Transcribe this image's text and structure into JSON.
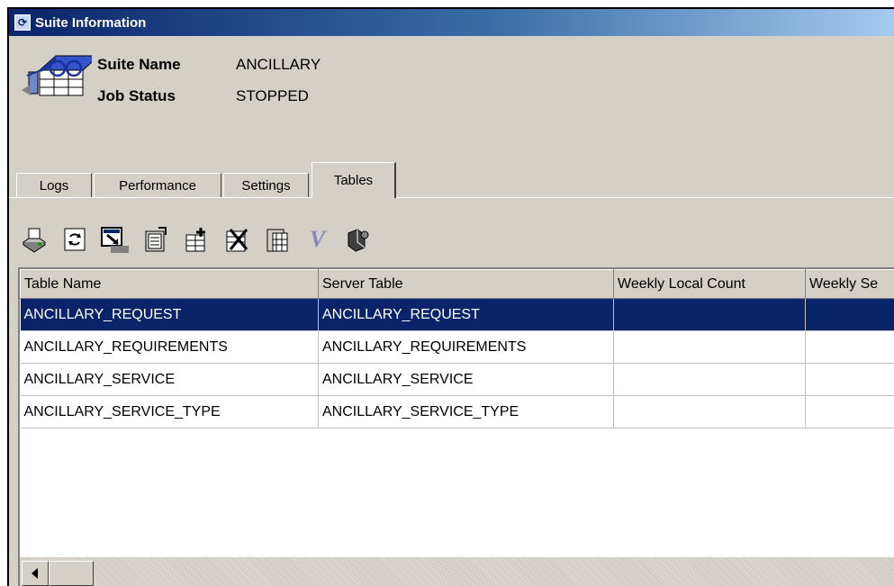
{
  "window": {
    "title": "Suite Information"
  },
  "suite": {
    "name_label": "Suite Name",
    "name_value": "ANCILLARY",
    "status_label": "Job Status",
    "status_value": "STOPPED"
  },
  "tabs": [
    {
      "label": "Logs"
    },
    {
      "label": "Performance"
    },
    {
      "label": "Settings"
    },
    {
      "label": "Tables",
      "active": true
    }
  ],
  "toolbar": {
    "buttons": [
      "print-icon",
      "refresh-icon",
      "export-icon",
      "properties-icon",
      "add-table-icon",
      "delete-table-icon",
      "paste-table-icon",
      "validate-icon",
      "run-icon"
    ],
    "validate_glyph": "V"
  },
  "table": {
    "columns": [
      "Table Name",
      "Server Table",
      "Weekly Local Count",
      "Weekly Se"
    ],
    "rows": [
      [
        "ANCILLARY_REQUEST",
        "ANCILLARY_REQUEST",
        "",
        ""
      ],
      [
        "ANCILLARY_REQUIREMENTS",
        "ANCILLARY_REQUIREMENTS",
        "",
        ""
      ],
      [
        "ANCILLARY_SERVICE",
        "ANCILLARY_SERVICE",
        "",
        ""
      ],
      [
        "ANCILLARY_SERVICE_TYPE",
        "ANCILLARY_SERVICE_TYPE",
        "",
        ""
      ]
    ],
    "selected_row": 0
  },
  "colors": {
    "selection": "#0a246a",
    "title_gradient_start": "#0a246a",
    "title_gradient_end": "#a6caf0",
    "face": "#d4d0c8"
  }
}
